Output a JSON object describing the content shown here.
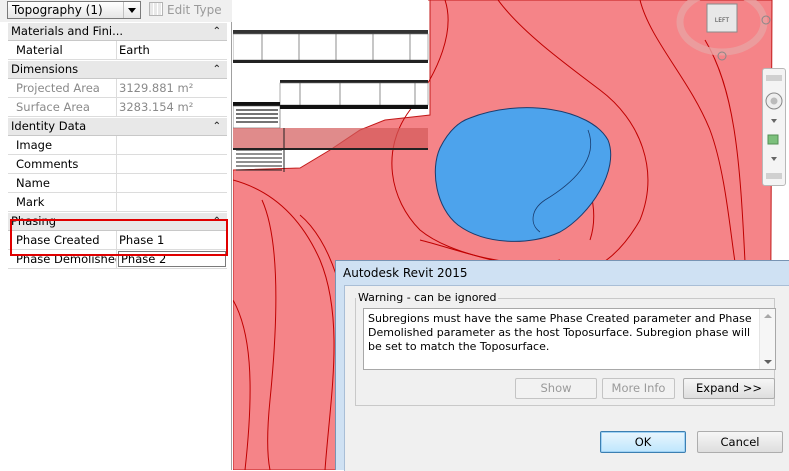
{
  "properties": {
    "type_selector": "Topography (1)",
    "edit_type_label": "Edit Type",
    "categories": [
      {
        "name": "Materials and Fini...",
        "rows": [
          {
            "key": "Material",
            "value": "Earth",
            "readonly": false
          }
        ]
      },
      {
        "name": "Dimensions",
        "rows": [
          {
            "key": "Projected Area",
            "value": "3129.881 m²",
            "readonly": true
          },
          {
            "key": "Surface Area",
            "value": "3283.154 m²",
            "readonly": true
          }
        ]
      },
      {
        "name": "Identity Data",
        "rows": [
          {
            "key": "Image",
            "value": "",
            "readonly": false
          },
          {
            "key": "Comments",
            "value": "",
            "readonly": false
          },
          {
            "key": "Name",
            "value": "",
            "readonly": false
          },
          {
            "key": "Mark",
            "value": "",
            "readonly": false
          }
        ]
      },
      {
        "name": "Phasing",
        "rows": [
          {
            "key": "Phase Created",
            "value": "Phase 1",
            "readonly": false
          },
          {
            "key": "Phase Demolished",
            "value": "Phase 2",
            "readonly": false
          }
        ]
      }
    ]
  },
  "viewcube": {
    "face_label": "LEFT"
  },
  "dialog": {
    "title": "Autodesk Revit 2015",
    "group_label": "Warning - can be ignored",
    "message": "Subregions must have the same Phase Created parameter and Phase Demolished parameter as the host Toposurface. Subregion phase will be set to match the Toposurface.",
    "buttons": {
      "show": "Show",
      "more_info": "More Info",
      "expand": "Expand >>",
      "ok": "OK",
      "cancel": "Cancel"
    }
  },
  "colors": {
    "topo_fill": "#f4777b",
    "subregion_fill": "#4da3ec",
    "highlight": "#e00000",
    "dialog_frame": "#cfe1f3"
  }
}
